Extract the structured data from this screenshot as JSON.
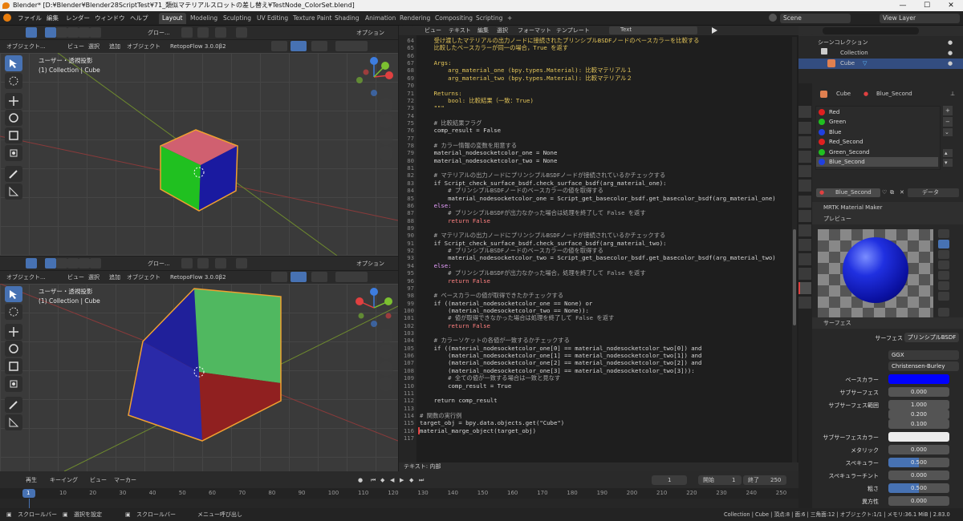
{
  "title": "Blender* [D:¥Blender¥Blender28ScriptTest¥71_類似マテリアルスロットの差し替え¥TestNode_ColorSet.blend]",
  "window_controls": [
    "—",
    "☐",
    "✕"
  ],
  "menu": [
    "ファイル",
    "編集",
    "レンダー",
    "ウィンドウ",
    "ヘルプ"
  ],
  "workspaces": [
    "Layout",
    "Modeling",
    "Sculpting",
    "UV Editing",
    "Texture Paint",
    "Shading",
    "Animation",
    "Rendering",
    "Compositing",
    "Scripting",
    "+"
  ],
  "scene": "Scene",
  "view_layer": "View Layer",
  "viewport": {
    "mode": "オブジェクト...",
    "orient": "グロー...",
    "menu": [
      "ビュー",
      "選択",
      "追加",
      "オブジェクト"
    ],
    "addon": "RetopoFlow 3.0.0β2",
    "options": "オプション",
    "view_name": "ユーザー・透視投影",
    "collection": "(1) Collection | Cube"
  },
  "text_editor": {
    "menu": [
      "ビュー",
      "テキスト",
      "編集",
      "選択",
      "フォーマット",
      "テンプレート"
    ],
    "text_name": "Text",
    "footer": "テキスト: 内部",
    "lines": [
      {
        "n": "64",
        "t": "    受け渡したマテリアルの出力ノードに接続されたプリンシプルBSDFノードのベースカラーを比較する",
        "c": "#e6c75a"
      },
      {
        "n": "65",
        "t": "    比較したベースカラーが同一の場合，True を返す",
        "c": "#e6c75a"
      },
      {
        "n": "66",
        "t": "",
        "c": "#e6c75a"
      },
      {
        "n": "67",
        "t": "    Args:",
        "c": "#e6c75a"
      },
      {
        "n": "68",
        "t": "        arg_material_one (bpy.types.Material): 比較マテリアル１",
        "c": "#e6c75a"
      },
      {
        "n": "69",
        "t": "        arg_material_two (bpy.types.Material): 比較マテリアル２",
        "c": "#e6c75a"
      },
      {
        "n": "70",
        "t": "",
        "c": "#e6c75a"
      },
      {
        "n": "71",
        "t": "    Returns:",
        "c": "#e6c75a"
      },
      {
        "n": "72",
        "t": "        bool: 比較結果（一致：True)",
        "c": "#e6c75a"
      },
      {
        "n": "73",
        "t": "    \"\"\"",
        "c": "#e6c75a"
      },
      {
        "n": "74",
        "t": "",
        "c": "#d8d8d8"
      },
      {
        "n": "75",
        "t": "    # 比較結果フラグ",
        "c": "#a8a8a8"
      },
      {
        "n": "76",
        "t": "    comp_result = False",
        "c": "#d8d8d8"
      },
      {
        "n": "77",
        "t": "",
        "c": "#d8d8d8"
      },
      {
        "n": "78",
        "t": "    # カラー情報の変数を用意する",
        "c": "#a8a8a8"
      },
      {
        "n": "79",
        "t": "    material_nodesocketcolor_one = None",
        "c": "#d8d8d8"
      },
      {
        "n": "80",
        "t": "    material_nodesocketcolor_two = None",
        "c": "#d8d8d8"
      },
      {
        "n": "81",
        "t": "",
        "c": "#d8d8d8"
      },
      {
        "n": "82",
        "t": "    # マテリアルの出力ノードにプリンシプルBSDFノードが接続されているかチェックする",
        "c": "#a8a8a8"
      },
      {
        "n": "83",
        "t": "    if Script_check_surface_bsdf.check_surface_bsdf(arg_material_one):",
        "c": "#d8d8d8"
      },
      {
        "n": "84",
        "t": "        # プリンシプルBSDFノードのベースカラーの値を取得する",
        "c": "#a8a8a8"
      },
      {
        "n": "85",
        "t": "        material_nodesocketcolor_one = Script_get_basecolor_bsdf.get_basecolor_bsdf(arg_material_one)",
        "c": "#d8d8d8"
      },
      {
        "n": "86",
        "t": "    else:",
        "c": "#e8a0ff"
      },
      {
        "n": "87",
        "t": "        # プリンシプルBSDFが出力なかった場合は処理を終了して False を返す",
        "c": "#a8a8a8"
      },
      {
        "n": "88",
        "t": "        return False",
        "c": "#ff8080"
      },
      {
        "n": "89",
        "t": "",
        "c": "#d8d8d8"
      },
      {
        "n": "90",
        "t": "    # マテリアルの出力ノードにプリンシプルBSDFノードが接続されているかチェックする",
        "c": "#a8a8a8"
      },
      {
        "n": "91",
        "t": "    if Script_check_surface_bsdf.check_surface_bsdf(arg_material_two):",
        "c": "#d8d8d8"
      },
      {
        "n": "92",
        "t": "        # プリンシプルBSDFノードのベースカラーの値を取得する",
        "c": "#a8a8a8"
      },
      {
        "n": "93",
        "t": "        material_nodesocketcolor_two = Script_get_basecolor_bsdf.get_basecolor_bsdf(arg_material_two)",
        "c": "#d8d8d8"
      },
      {
        "n": "94",
        "t": "    else:",
        "c": "#e8a0ff"
      },
      {
        "n": "95",
        "t": "        # プリンシプルBSDFが出力なかった場合，処理を終了して False を返す",
        "c": "#a8a8a8"
      },
      {
        "n": "96",
        "t": "        return False",
        "c": "#ff8080"
      },
      {
        "n": "97",
        "t": "",
        "c": "#d8d8d8"
      },
      {
        "n": "98",
        "t": "    # ベースカラーの値が取得できたかチェックする",
        "c": "#a8a8a8"
      },
      {
        "n": "99",
        "t": "    if ((material_nodesocketcolor_one == None) or",
        "c": "#d8d8d8"
      },
      {
        "n": "100",
        "t": "        (material_nodesocketcolor_two == None)):",
        "c": "#d8d8d8"
      },
      {
        "n": "101",
        "t": "        # 値が取得できなかった場合は処理を終了して False を返す",
        "c": "#a8a8a8"
      },
      {
        "n": "102",
        "t": "        return False",
        "c": "#ff8080"
      },
      {
        "n": "103",
        "t": "",
        "c": "#d8d8d8"
      },
      {
        "n": "104",
        "t": "    # カラーソケットの各値が一致するかチェックする",
        "c": "#a8a8a8"
      },
      {
        "n": "105",
        "t": "    if ((material_nodesocketcolor_one[0] == material_nodesocketcolor_two[0]) and",
        "c": "#d8d8d8"
      },
      {
        "n": "106",
        "t": "        (material_nodesocketcolor_one[1] == material_nodesocketcolor_two[1]) and",
        "c": "#d8d8d8"
      },
      {
        "n": "107",
        "t": "        (material_nodesocketcolor_one[2] == material_nodesocketcolor_two[2]) and",
        "c": "#d8d8d8"
      },
      {
        "n": "108",
        "t": "        (material_nodesocketcolor_one[3] == material_nodesocketcolor_two[3])):",
        "c": "#d8d8d8"
      },
      {
        "n": "109",
        "t": "        # 全ての値が一致する場合は一致と見なす",
        "c": "#a8a8a8"
      },
      {
        "n": "110",
        "t": "        comp_result = True",
        "c": "#d8d8d8"
      },
      {
        "n": "111",
        "t": "",
        "c": "#d8d8d8"
      },
      {
        "n": "112",
        "t": "    return comp_result",
        "c": "#d8d8d8"
      },
      {
        "n": "113",
        "t": "",
        "c": "#d8d8d8"
      },
      {
        "n": "114",
        "t": "# 関数の実行例",
        "c": "#a8a8a8"
      },
      {
        "n": "115",
        "t": "target_obj = bpy.data.objects.get(\"Cube\")",
        "c": "#d8d8d8"
      },
      {
        "n": "116",
        "t": "material_marge_object(target_obj)",
        "c": "#d8d8d8"
      },
      {
        "n": "117",
        "t": "",
        "c": "#d8d8d8"
      }
    ]
  },
  "outliner": {
    "title": "シーンコレクション",
    "collection": "Collection",
    "object": "Cube"
  },
  "properties": {
    "object": "Cube",
    "material": "Blue_Second",
    "slots": [
      {
        "name": "Red",
        "color": "#e02020"
      },
      {
        "name": "Green",
        "color": "#20c020"
      },
      {
        "name": "Blue",
        "color": "#2040e0"
      },
      {
        "name": "Red_Second",
        "color": "#e02020"
      },
      {
        "name": "Green_Second",
        "color": "#20c020"
      },
      {
        "name": "Blue_Second",
        "color": "#2040e0"
      }
    ],
    "active_material": "Blue_Second",
    "data_label": "データ",
    "panel_mrtk": "MRTK Material Maker",
    "panel_preview": "プレビュー",
    "panel_surface": "サーフェス",
    "surface_label": "サーフェス",
    "surface_value": "プリンシプルBSDF",
    "distribution": "GGX",
    "subsurface_method": "Christensen-Burley",
    "base_color_label": "ベースカラー",
    "base_color": "#0000ff",
    "subsurface_label": "サブサーフェス",
    "subsurface": "0.000",
    "radius_label": "サブサーフェス範囲",
    "radius": [
      "1.000",
      "0.200",
      "0.100"
    ],
    "subsurface_color_label": "サブサーフェスカラー",
    "metallic_label": "メタリック",
    "metallic": "0.000",
    "specular_label": "スペキュラー",
    "specular": "0.500",
    "specular_tint_label": "スペキュラーチント",
    "specular_tint": "0.000",
    "roughness_label": "粗さ",
    "roughness": "0.500",
    "anisotropic_label": "異方性",
    "anisotropic": "0.000"
  },
  "timeline": {
    "menu": [
      "再生",
      "キーイング",
      "ビュー",
      "マーカー"
    ],
    "current_frame": "1",
    "start_label": "開始",
    "start": "1",
    "end_label": "終了",
    "end": "250",
    "ticks": [
      "10",
      "20",
      "30",
      "40",
      "50",
      "60",
      "70",
      "80",
      "90",
      "100",
      "110",
      "120",
      "130",
      "140",
      "150",
      "160",
      "170",
      "180",
      "190",
      "200",
      "210",
      "220",
      "230",
      "240",
      "250"
    ],
    "current_marker": "1"
  },
  "statusbar": {
    "items": [
      "スクロールバー",
      "選択を設定",
      "スクロールバー",
      "メニュー呼び出し"
    ],
    "info": "Collection | Cube | 頂点:8 | 面:6 | 三角面:12 | オブジェクト:1/1 | メモリ:36.1 MiB | 2.83.0"
  },
  "colors": {
    "accent": "#4772b3",
    "logo": "#e87d0d"
  },
  "icons": [
    "blender-logo-icon",
    "select-box-icon",
    "cursor-icon",
    "move-icon",
    "rotate-icon",
    "scale-icon",
    "transform-icon",
    "annotate-icon",
    "measure-icon",
    "zoom-icon",
    "hand-icon",
    "camera-icon",
    "grid-icon",
    "eye-icon",
    "play-icon",
    "render-icon",
    "output-icon",
    "scene-icon",
    "world-icon",
    "object-icon",
    "modifier-icon",
    "particles-icon",
    "physics-icon",
    "constraint-icon",
    "data-icon",
    "material-icon",
    "texture-icon"
  ]
}
